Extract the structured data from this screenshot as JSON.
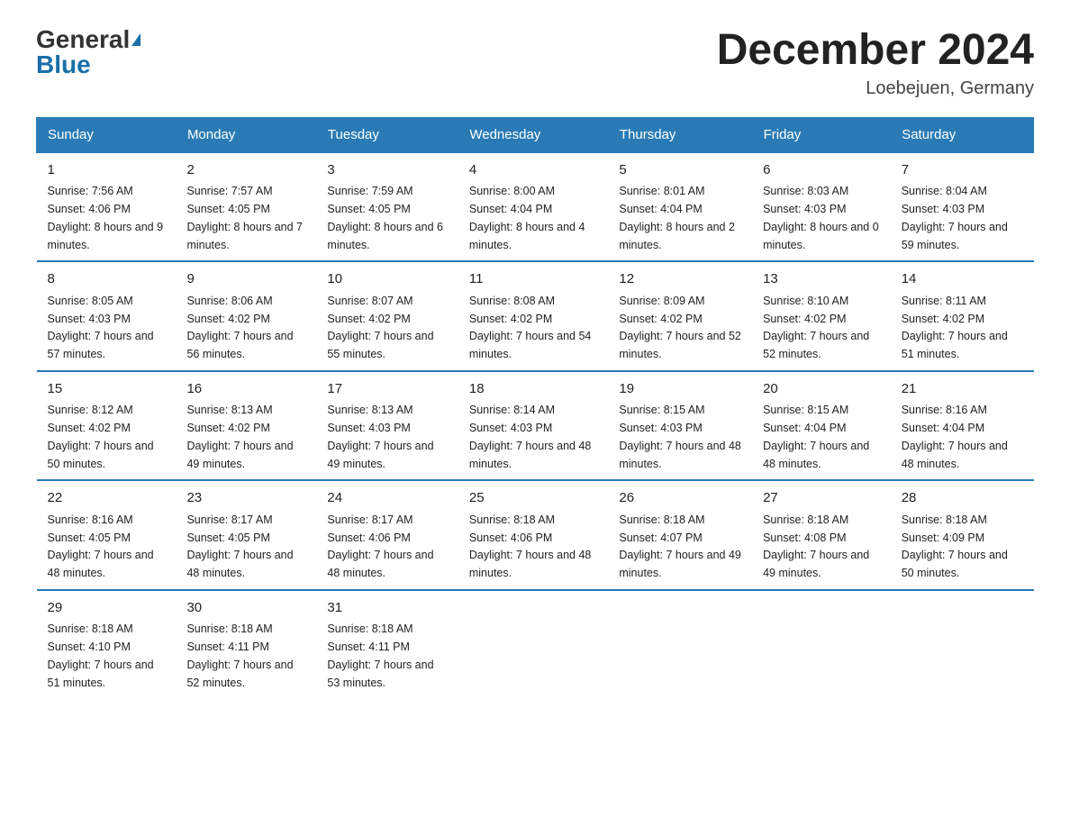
{
  "logo": {
    "general": "General",
    "blue": "Blue"
  },
  "title": "December 2024",
  "subtitle": "Loebejuen, Germany",
  "headers": [
    "Sunday",
    "Monday",
    "Tuesday",
    "Wednesday",
    "Thursday",
    "Friday",
    "Saturday"
  ],
  "weeks": [
    [
      {
        "day": "1",
        "sunrise": "7:56 AM",
        "sunset": "4:06 PM",
        "daylight": "8 hours and 9 minutes."
      },
      {
        "day": "2",
        "sunrise": "7:57 AM",
        "sunset": "4:05 PM",
        "daylight": "8 hours and 7 minutes."
      },
      {
        "day": "3",
        "sunrise": "7:59 AM",
        "sunset": "4:05 PM",
        "daylight": "8 hours and 6 minutes."
      },
      {
        "day": "4",
        "sunrise": "8:00 AM",
        "sunset": "4:04 PM",
        "daylight": "8 hours and 4 minutes."
      },
      {
        "day": "5",
        "sunrise": "8:01 AM",
        "sunset": "4:04 PM",
        "daylight": "8 hours and 2 minutes."
      },
      {
        "day": "6",
        "sunrise": "8:03 AM",
        "sunset": "4:03 PM",
        "daylight": "8 hours and 0 minutes."
      },
      {
        "day": "7",
        "sunrise": "8:04 AM",
        "sunset": "4:03 PM",
        "daylight": "7 hours and 59 minutes."
      }
    ],
    [
      {
        "day": "8",
        "sunrise": "8:05 AM",
        "sunset": "4:03 PM",
        "daylight": "7 hours and 57 minutes."
      },
      {
        "day": "9",
        "sunrise": "8:06 AM",
        "sunset": "4:02 PM",
        "daylight": "7 hours and 56 minutes."
      },
      {
        "day": "10",
        "sunrise": "8:07 AM",
        "sunset": "4:02 PM",
        "daylight": "7 hours and 55 minutes."
      },
      {
        "day": "11",
        "sunrise": "8:08 AM",
        "sunset": "4:02 PM",
        "daylight": "7 hours and 54 minutes."
      },
      {
        "day": "12",
        "sunrise": "8:09 AM",
        "sunset": "4:02 PM",
        "daylight": "7 hours and 52 minutes."
      },
      {
        "day": "13",
        "sunrise": "8:10 AM",
        "sunset": "4:02 PM",
        "daylight": "7 hours and 52 minutes."
      },
      {
        "day": "14",
        "sunrise": "8:11 AM",
        "sunset": "4:02 PM",
        "daylight": "7 hours and 51 minutes."
      }
    ],
    [
      {
        "day": "15",
        "sunrise": "8:12 AM",
        "sunset": "4:02 PM",
        "daylight": "7 hours and 50 minutes."
      },
      {
        "day": "16",
        "sunrise": "8:13 AM",
        "sunset": "4:02 PM",
        "daylight": "7 hours and 49 minutes."
      },
      {
        "day": "17",
        "sunrise": "8:13 AM",
        "sunset": "4:03 PM",
        "daylight": "7 hours and 49 minutes."
      },
      {
        "day": "18",
        "sunrise": "8:14 AM",
        "sunset": "4:03 PM",
        "daylight": "7 hours and 48 minutes."
      },
      {
        "day": "19",
        "sunrise": "8:15 AM",
        "sunset": "4:03 PM",
        "daylight": "7 hours and 48 minutes."
      },
      {
        "day": "20",
        "sunrise": "8:15 AM",
        "sunset": "4:04 PM",
        "daylight": "7 hours and 48 minutes."
      },
      {
        "day": "21",
        "sunrise": "8:16 AM",
        "sunset": "4:04 PM",
        "daylight": "7 hours and 48 minutes."
      }
    ],
    [
      {
        "day": "22",
        "sunrise": "8:16 AM",
        "sunset": "4:05 PM",
        "daylight": "7 hours and 48 minutes."
      },
      {
        "day": "23",
        "sunrise": "8:17 AM",
        "sunset": "4:05 PM",
        "daylight": "7 hours and 48 minutes."
      },
      {
        "day": "24",
        "sunrise": "8:17 AM",
        "sunset": "4:06 PM",
        "daylight": "7 hours and 48 minutes."
      },
      {
        "day": "25",
        "sunrise": "8:18 AM",
        "sunset": "4:06 PM",
        "daylight": "7 hours and 48 minutes."
      },
      {
        "day": "26",
        "sunrise": "8:18 AM",
        "sunset": "4:07 PM",
        "daylight": "7 hours and 49 minutes."
      },
      {
        "day": "27",
        "sunrise": "8:18 AM",
        "sunset": "4:08 PM",
        "daylight": "7 hours and 49 minutes."
      },
      {
        "day": "28",
        "sunrise": "8:18 AM",
        "sunset": "4:09 PM",
        "daylight": "7 hours and 50 minutes."
      }
    ],
    [
      {
        "day": "29",
        "sunrise": "8:18 AM",
        "sunset": "4:10 PM",
        "daylight": "7 hours and 51 minutes."
      },
      {
        "day": "30",
        "sunrise": "8:18 AM",
        "sunset": "4:11 PM",
        "daylight": "7 hours and 52 minutes."
      },
      {
        "day": "31",
        "sunrise": "8:18 AM",
        "sunset": "4:11 PM",
        "daylight": "7 hours and 53 minutes."
      },
      null,
      null,
      null,
      null
    ]
  ]
}
